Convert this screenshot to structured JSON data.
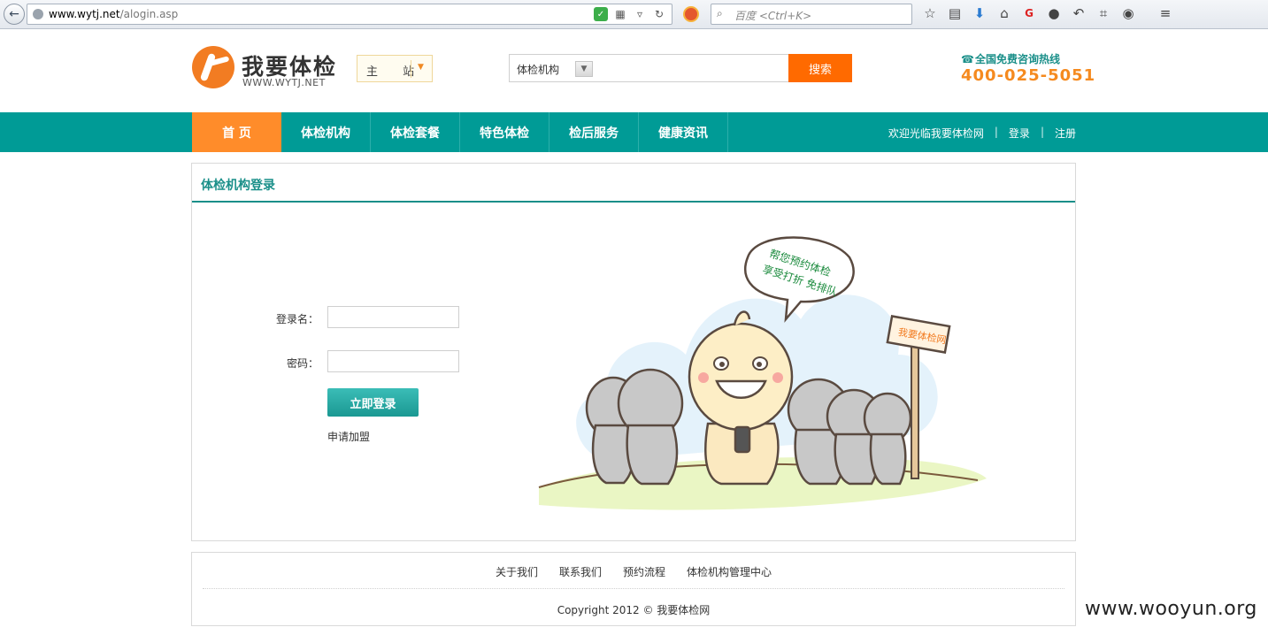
{
  "browser": {
    "url_host": "www.wytj.net",
    "url_path": "/alogin.asp",
    "search_placeholder": "百度 <Ctrl+K>",
    "toolbar_icons": [
      "star-icon",
      "bookmarks-icon",
      "download-icon",
      "home-icon",
      "gm-icon",
      "chat-icon",
      "undo-icon",
      "crop-icon",
      "comment-icon",
      "menu-icon"
    ]
  },
  "header": {
    "logo_text": "我要体检",
    "logo_subtext": "WWW.WYTJ.NET",
    "site_switch_label": "主 站",
    "search_category": "体检机构",
    "search_button": "搜索",
    "hotline_label": "全国免费咨询热线",
    "hotline_number": "400-025-5051"
  },
  "nav": {
    "items": [
      {
        "label": "首 页",
        "active": true
      },
      {
        "label": "体检机构",
        "active": false
      },
      {
        "label": "体检套餐",
        "active": false
      },
      {
        "label": "特色体检",
        "active": false
      },
      {
        "label": "检后服务",
        "active": false
      },
      {
        "label": "健康资讯",
        "active": false
      }
    ],
    "welcome": "欢迎光临我要体检网",
    "login": "登录",
    "register": "注册",
    "separator": "|"
  },
  "login_panel": {
    "title": "体检机构登录",
    "username_label": "登录名：",
    "password_label": "密码：",
    "submit_label": "立即登录",
    "apply_link": "申请加盟",
    "bubble_line1": "帮您预约体检",
    "bubble_line2": "享受打折 免排队",
    "sign_text": "我要体检网"
  },
  "footer": {
    "links": [
      "关于我们",
      "联系我们",
      "预约流程",
      "体检机构管理中心"
    ],
    "copyright": "Copyright 2012 © 我要体检网"
  },
  "watermark": "www.wooyun.org",
  "colors": {
    "teal": "#009b96",
    "orange": "#ff8c2a",
    "search_orange": "#ff6a00",
    "hotline_orange": "#f58a1f"
  }
}
